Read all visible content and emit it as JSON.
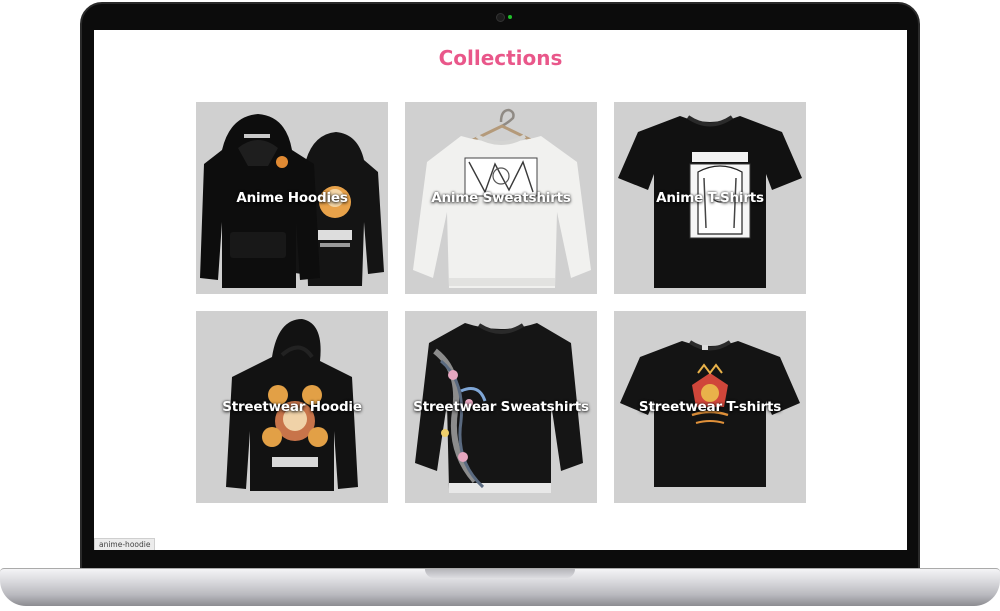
{
  "page": {
    "title": "Collections",
    "title_color": "#e9578a"
  },
  "collections": [
    {
      "label": "Anime Hoodies",
      "garment": "hoodie",
      "product_color": "#111111"
    },
    {
      "label": "Anime Sweatshirts",
      "garment": "sweatshirt",
      "product_color": "#f1f1ef"
    },
    {
      "label": "Anime T-Shirts",
      "garment": "tshirt",
      "product_color": "#111111"
    },
    {
      "label": "Streetwear Hoodie",
      "garment": "hoodie",
      "product_color": "#121212"
    },
    {
      "label": "Streetwear Sweatshirts",
      "garment": "sweatshirt",
      "product_color": "#151515"
    },
    {
      "label": "Streetwear T-shirts",
      "garment": "tshirt",
      "product_color": "#141414"
    }
  ],
  "status_bar": {
    "link_preview": "anime-hoodie"
  }
}
